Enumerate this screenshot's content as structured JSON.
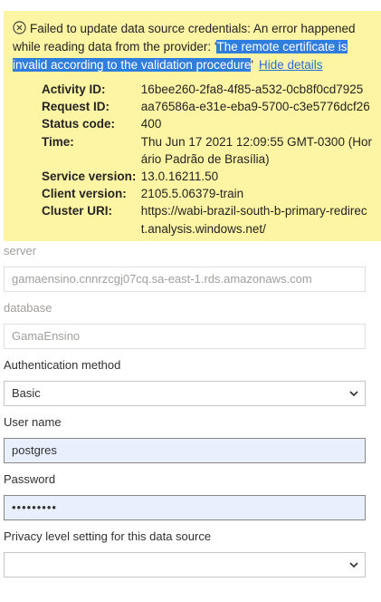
{
  "error": {
    "message_before": "Failed to update data source credentials: An error happened while reading data from the provider: '",
    "message_highlight": "The remote certificate is invalid according to the validation procedure",
    "message_after": "'",
    "hide_details": "Hide details",
    "details": [
      {
        "key": "Activity ID:",
        "value": "16bee260-2fa8-4f85-a532-0cb8f0cd7925"
      },
      {
        "key": "Request ID:",
        "value": "aa76586a-e31e-eba9-5700-c3e5776dcf26"
      },
      {
        "key": "Status code:",
        "value": "400"
      },
      {
        "key": "Time:",
        "value": "Thu Jun 17 2021 12:09:55 GMT-0300 (Horário Padrão de Brasília)"
      },
      {
        "key": "Service version:",
        "value": "13.0.16211.50"
      },
      {
        "key": "Client version:",
        "value": "2105.5.06379-train"
      },
      {
        "key": "Cluster URI:",
        "value": "https://wabi-brazil-south-b-primary-redirect.analysis.windows.net/"
      }
    ]
  },
  "form": {
    "server_label": "server",
    "server_value": "gamaensino.cnnrzcgj07cq.sa-east-1.rds.amazonaws.com",
    "database_label": "database",
    "database_value": "GamaEnsino",
    "auth_label": "Authentication method",
    "auth_value": "Basic",
    "username_label": "User name",
    "username_value": "postgres",
    "password_label": "Password",
    "password_value": "•••••••••",
    "privacy_label": "Privacy level setting for this data source",
    "privacy_value": ""
  },
  "icons": {
    "error": "circle-x-icon",
    "dropdown": "chevron-down-icon"
  }
}
